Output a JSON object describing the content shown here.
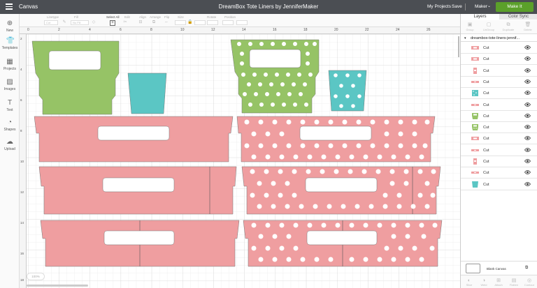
{
  "topbar": {
    "app_name": "Canvas",
    "title": "DreamBox Tote Liners by JenniferMaker",
    "my_projects": "My Projects",
    "save": "Save",
    "machine": "Maker",
    "make_button": "Make It"
  },
  "toolbar": {
    "items": [
      "Linetype",
      "Fill",
      "Select All",
      "Edit",
      "Align",
      "Arrange",
      "Flip",
      "Size",
      "Rotate",
      "Position"
    ],
    "linetype_value": "Cut",
    "fill_value": "No Fill",
    "select_all_glyph": "+"
  },
  "leftbar": {
    "items": [
      "New",
      "Templates",
      "Projects",
      "Images",
      "Text",
      "Shapes",
      "Upload"
    ]
  },
  "ruler": {
    "top_labels": [
      "0",
      "2",
      "4",
      "6",
      "8",
      "10",
      "12",
      "14",
      "16",
      "18",
      "20",
      "22",
      "24",
      "26"
    ],
    "left_labels": [
      "2",
      "4",
      "6",
      "8",
      "10",
      "12",
      "14",
      "16",
      "18"
    ]
  },
  "zoom": "100%",
  "panel": {
    "tabs": [
      "Layers",
      "Color Sync"
    ],
    "top_actions": [
      "Group",
      "UnGroup",
      "Duplicate",
      "Delete"
    ],
    "group_name": "dreambox-tote-liners-jennif...",
    "layers": [
      {
        "label": "Cut",
        "color": "#ef9ea0",
        "shape": "sideband"
      },
      {
        "label": "Cut",
        "color": "#ef9ea0",
        "shape": "sideband"
      },
      {
        "label": "Cut",
        "color": "#ef9ea0",
        "shape": "tall"
      },
      {
        "label": "Cut",
        "color": "#ef9ea0",
        "shape": "band"
      },
      {
        "label": "Cut",
        "color": "#5bc6c4",
        "shape": "dots"
      },
      {
        "label": "Cut",
        "color": "#ef9ea0",
        "shape": "band"
      },
      {
        "label": "Cut",
        "color": "#96c366",
        "shape": "tote"
      },
      {
        "label": "Cut",
        "color": "#96c366",
        "shape": "dotstote"
      },
      {
        "label": "Cut",
        "color": "#ef9ea0",
        "shape": "sideband"
      },
      {
        "label": "Cut",
        "color": "#ef9ea0",
        "shape": "band"
      },
      {
        "label": "Cut",
        "color": "#ef9ea0",
        "shape": "tall"
      },
      {
        "label": "Cut",
        "color": "#ef9ea0",
        "shape": "band"
      },
      {
        "label": "Cut",
        "color": "#5bc6c4",
        "shape": "cup"
      }
    ],
    "blank_canvas": "Blank Canvas",
    "bottom_actions": [
      "Slice",
      "Weld",
      "Attach",
      "Flatten",
      "Contour"
    ]
  },
  "colors": {
    "pink": "#ef9ea0",
    "green": "#96c366",
    "teal": "#5bc6c4",
    "make_green": "#5ba02a",
    "topbar": "#4b4e53"
  }
}
